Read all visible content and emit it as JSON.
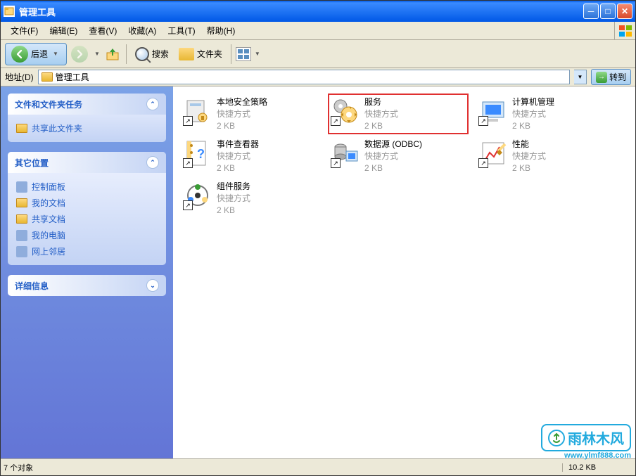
{
  "window": {
    "title": "管理工具"
  },
  "menus": [
    {
      "label": "文件(F)"
    },
    {
      "label": "编辑(E)"
    },
    {
      "label": "查看(V)"
    },
    {
      "label": "收藏(A)"
    },
    {
      "label": "工具(T)"
    },
    {
      "label": "帮助(H)"
    }
  ],
  "toolbar": {
    "back": "后退",
    "search": "搜索",
    "folders": "文件夹"
  },
  "address": {
    "label": "地址(D)",
    "value": "管理工具",
    "go": "转到"
  },
  "sidebar": {
    "tasks": {
      "title": "文件和文件夹任务",
      "items": [
        {
          "label": "共享此文件夹"
        }
      ]
    },
    "places": {
      "title": "其它位置",
      "items": [
        {
          "label": "控制面板"
        },
        {
          "label": "我的文档"
        },
        {
          "label": "共享文档"
        },
        {
          "label": "我的电脑"
        },
        {
          "label": "网上邻居"
        }
      ]
    },
    "details": {
      "title": "详细信息"
    }
  },
  "files": [
    {
      "name": "本地安全策略",
      "type": "快捷方式",
      "size": "2 KB",
      "highlighted": false,
      "row": 0,
      "col": 0
    },
    {
      "name": "服务",
      "type": "快捷方式",
      "size": "2 KB",
      "highlighted": true,
      "row": 0,
      "col": 1
    },
    {
      "name": "计算机管理",
      "type": "快捷方式",
      "size": "2 KB",
      "highlighted": false,
      "row": 0,
      "col": 2
    },
    {
      "name": "事件查看器",
      "type": "快捷方式",
      "size": "2 KB",
      "highlighted": false,
      "row": 1,
      "col": 0
    },
    {
      "name": "数据源 (ODBC)",
      "type": "快捷方式",
      "size": "2 KB",
      "highlighted": false,
      "row": 1,
      "col": 1
    },
    {
      "name": "性能",
      "type": "快捷方式",
      "size": "2 KB",
      "highlighted": false,
      "row": 1,
      "col": 2
    },
    {
      "name": "组件服务",
      "type": "快捷方式",
      "size": "2 KB",
      "highlighted": false,
      "row": 2,
      "col": 0
    }
  ],
  "statusbar": {
    "left": "7 个对象",
    "right": "10.2 KB"
  },
  "watermark": {
    "text": "雨林木风",
    "url": "www.ylmf888.com"
  },
  "colors": {
    "titlebar_start": "#0058e6",
    "sidebar_link": "#215dc6",
    "highlight_border": "#e03030"
  }
}
